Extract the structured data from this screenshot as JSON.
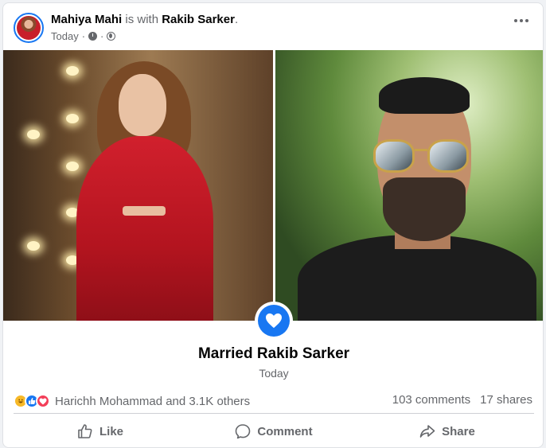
{
  "post": {
    "author": "Mahiya Mahi",
    "with_text": "is with",
    "tagged": "Rakib Sarker",
    "period": ".",
    "time": "Today",
    "separator": "·"
  },
  "event": {
    "title": "Married Rakib Sarker",
    "date": "Today"
  },
  "engagement": {
    "reactors": "Harichh Mohammad and 3.1K others",
    "comments": "103 comments",
    "shares": "17 shares"
  },
  "actions": {
    "like": "Like",
    "comment": "Comment",
    "share": "Share"
  },
  "colors": {
    "accent": "#1877f2",
    "secondary_text": "#65676b",
    "love": "#f33e58",
    "haha": "#f7b928"
  },
  "icons": {
    "reactions": [
      "haha-icon",
      "like-icon",
      "love-icon"
    ],
    "privacy": "globe-icon",
    "badge": "heart-icon"
  }
}
